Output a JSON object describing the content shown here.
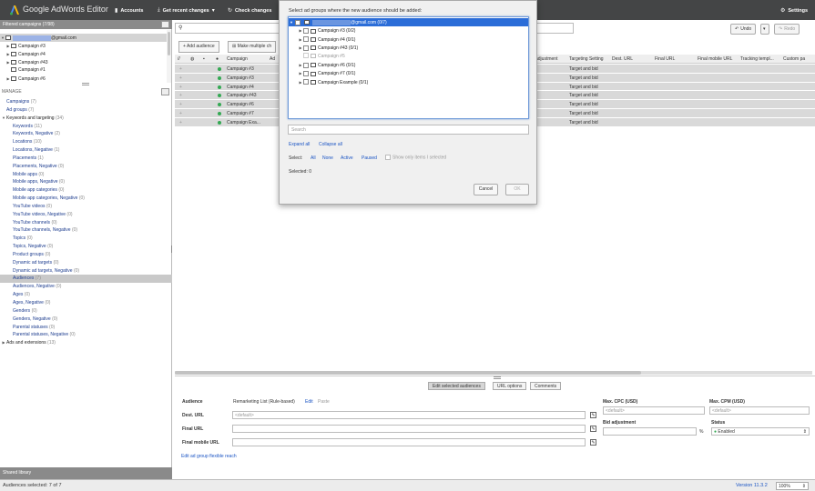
{
  "app": {
    "name": "Google AdWords Editor",
    "version": "Version 11.3.2",
    "toolbar": {
      "accounts": "Accounts",
      "get_recent": "Get recent changes",
      "check": "Check changes",
      "settings": "Settings"
    }
  },
  "left": {
    "filtered_header": "Filtered campaigns (7/98)",
    "account_email": "@gmail.com",
    "campaigns": [
      "Campaign #3",
      "Campaign #4",
      "Campaign #43",
      "Campaign #1",
      "Campaign #6"
    ],
    "manage_label": "MANAGE",
    "manage_items": [
      {
        "label": "Campaigns",
        "count": "(7)"
      },
      {
        "label": "Ad groups",
        "count": "(7)"
      },
      {
        "label": "Keywords and targeting",
        "count": "(34)"
      },
      {
        "label": "Keywords",
        "count": "(11)"
      },
      {
        "label": "Keywords, Negative",
        "count": "(2)"
      },
      {
        "label": "Locations",
        "count": "(10)"
      },
      {
        "label": "Locations, Negative",
        "count": "(1)"
      },
      {
        "label": "Placements",
        "count": "(1)"
      },
      {
        "label": "Placements, Negative",
        "count": "(0)"
      },
      {
        "label": "Mobile apps",
        "count": "(0)"
      },
      {
        "label": "Mobile apps, Negative",
        "count": "(0)"
      },
      {
        "label": "Mobile app categories",
        "count": "(0)"
      },
      {
        "label": "Mobile app categories, Negative",
        "count": "(0)"
      },
      {
        "label": "YouTube videos",
        "count": "(0)"
      },
      {
        "label": "YouTube videos, Negative",
        "count": "(0)"
      },
      {
        "label": "YouTube channels",
        "count": "(0)"
      },
      {
        "label": "YouTube channels, Negative",
        "count": "(0)"
      },
      {
        "label": "Topics",
        "count": "(0)"
      },
      {
        "label": "Topics, Negative",
        "count": "(0)"
      },
      {
        "label": "Product groups",
        "count": "(0)"
      },
      {
        "label": "Dynamic ad targets",
        "count": "(0)"
      },
      {
        "label": "Dynamic ad targets, Negative",
        "count": "(0)"
      },
      {
        "label": "Audiences",
        "count": "(7)"
      },
      {
        "label": "Audiences, Negative",
        "count": "(0)"
      },
      {
        "label": "Ages",
        "count": "(0)"
      },
      {
        "label": "Ages, Negative",
        "count": "(0)"
      },
      {
        "label": "Genders",
        "count": "(0)"
      },
      {
        "label": "Genders, Negative",
        "count": "(0)"
      },
      {
        "label": "Parental statuses",
        "count": "(0)"
      },
      {
        "label": "Parental statuses, Negative",
        "count": "(0)"
      },
      {
        "label": "Ads and extensions",
        "count": "(13)"
      }
    ],
    "shared_library": "Shared library"
  },
  "main": {
    "undo": "Undo",
    "redo": "Redo",
    "add_audience": "Add audience",
    "make_multiple": "Make multiple ch",
    "columns": [
      "Campaign",
      "Ad",
      "adjustment",
      "Targeting Setting",
      "Dest. URL",
      "Final URL",
      "Final mobile URL",
      "Tracking templ...",
      "Custom pa"
    ],
    "rows": [
      {
        "campaign": "Campaign #3",
        "targeting": "Target and bid"
      },
      {
        "campaign": "Campaign #3",
        "targeting": "Target and bid"
      },
      {
        "campaign": "Campaign #4",
        "targeting": "Target and bid"
      },
      {
        "campaign": "Campaign #43",
        "targeting": "Target and bid"
      },
      {
        "campaign": "Campaign #6",
        "targeting": "Target and bid"
      },
      {
        "campaign": "Campaign #7",
        "targeting": "Target and bid"
      },
      {
        "campaign": "Campaign Exa...",
        "targeting": "Target and bid"
      }
    ]
  },
  "bottom": {
    "tabs": [
      "Edit selected audiences",
      "URL options",
      "Comments"
    ],
    "audience_label": "Audience",
    "audience_value": "Remarketing List (Rule-based)",
    "edit": "Edit",
    "paste": "Paste",
    "dest_url": "Dest. URL",
    "dest_placeholder": "<default>",
    "final_url": "Final URL",
    "final_mobile_url": "Final mobile URL",
    "flex_reach": "Edit ad group flexible reach",
    "max_cpc": "Max. CPC (USD)",
    "max_cpm": "Max. CPM (USD)",
    "cpc_placeholder": "<default>",
    "cpm_placeholder": "<default>",
    "bid_adj": "Bid adjustment",
    "percent": "%",
    "status_label": "Status",
    "status_value": "Enabled"
  },
  "status_bar": {
    "selected": "Audiences selected: 7 of 7",
    "zoom": "100%"
  },
  "dialog": {
    "title": "Select ad groups where the new audience should be added:",
    "root": "@gmail.com (0/7)",
    "items": [
      {
        "label": "Campaign #3 (0/2)",
        "disabled": false
      },
      {
        "label": "Campaign #4 (0/1)",
        "disabled": false
      },
      {
        "label": "Campaign #43 (0/1)",
        "disabled": false
      },
      {
        "label": "Campaign #5",
        "disabled": true
      },
      {
        "label": "Campaign #6 (0/1)",
        "disabled": false
      },
      {
        "label": "Campaign #7 (0/1)",
        "disabled": false
      },
      {
        "label": "Campaign Example (0/1)",
        "disabled": false
      }
    ],
    "search_placeholder": "Search",
    "expand_all": "Expand all",
    "collapse_all": "Collapse all",
    "select_label": "Select:",
    "all": "All",
    "none": "None",
    "active": "Active",
    "paused": "Paused",
    "show_only": "Show only items I selected",
    "selected": "Selected: 0",
    "cancel": "Cancel",
    "ok": "OK"
  }
}
